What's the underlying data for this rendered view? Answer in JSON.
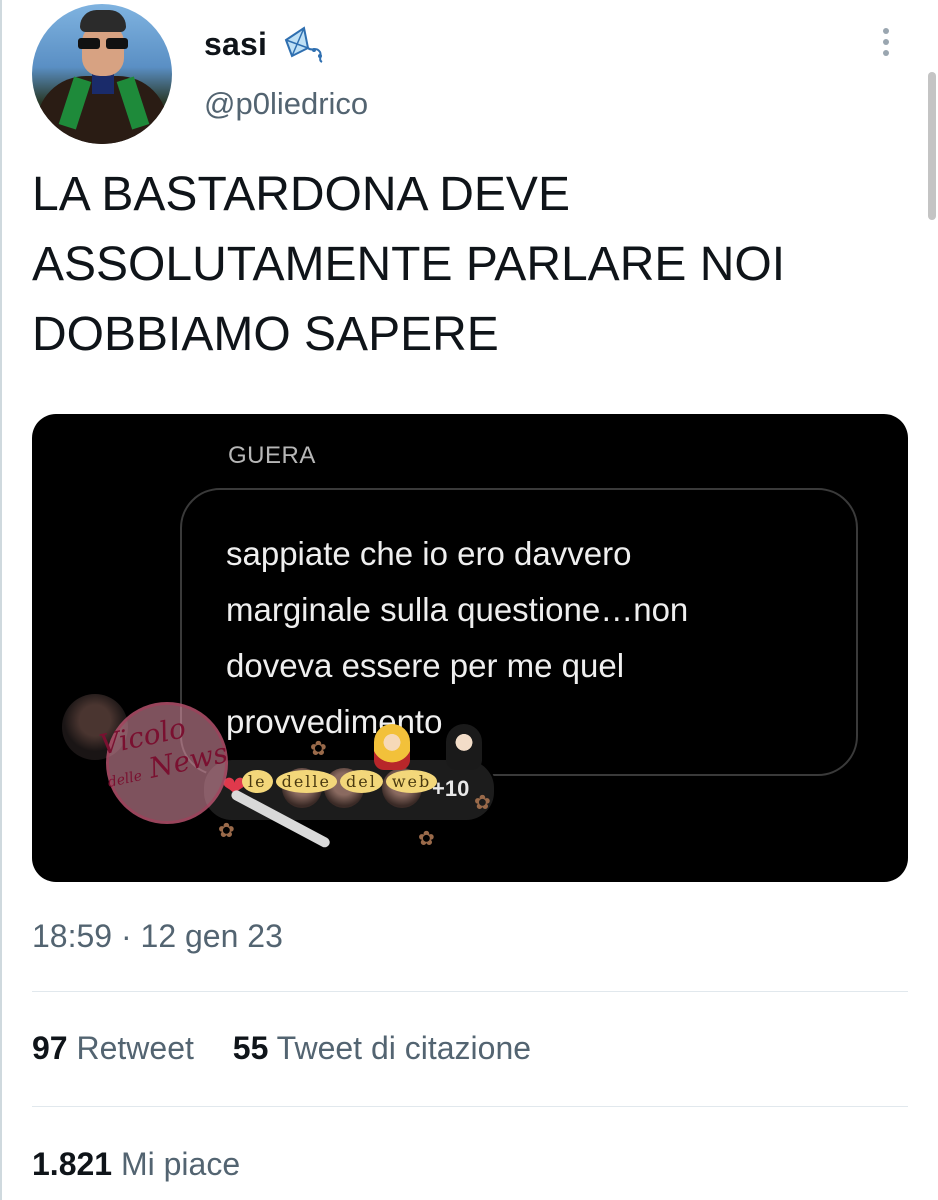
{
  "author": {
    "display_name": "sasi",
    "handle": "@p0liedrico"
  },
  "tweet": {
    "text_lines": [
      "LA BASTARDONA DEVE",
      "ASSOLUTAMENTE PARLARE NOI",
      "DOBBIAMO SAPERE"
    ]
  },
  "media": {
    "sender": "GUERA",
    "message_lines": [
      "sappiate che io ero davvero",
      "marginale sulla questione…non",
      "doveva essere per me quel",
      "provvedimento"
    ],
    "reaction_extra": "+10",
    "watermark_text": "Vicolo delle News",
    "sticker_text": [
      "le",
      "delle",
      "del",
      "web"
    ]
  },
  "meta": {
    "timestamp": "18:59 · 12 gen 23"
  },
  "stats": {
    "retweets_count": "97",
    "retweets_label": "Retweet",
    "quotes_count": "55",
    "quotes_label": "Tweet di citazione",
    "likes_count": "1.821",
    "likes_label": "Mi piace"
  },
  "icons": {
    "kite": "kite-icon",
    "more": "more-vertical-icon",
    "heart": "heart-icon",
    "paw": "paw-icon"
  },
  "colors": {
    "text_primary": "#0f1419",
    "text_secondary": "#536471",
    "media_bg": "#000000",
    "divider": "#e1e8ed",
    "heart": "#e0394c"
  }
}
